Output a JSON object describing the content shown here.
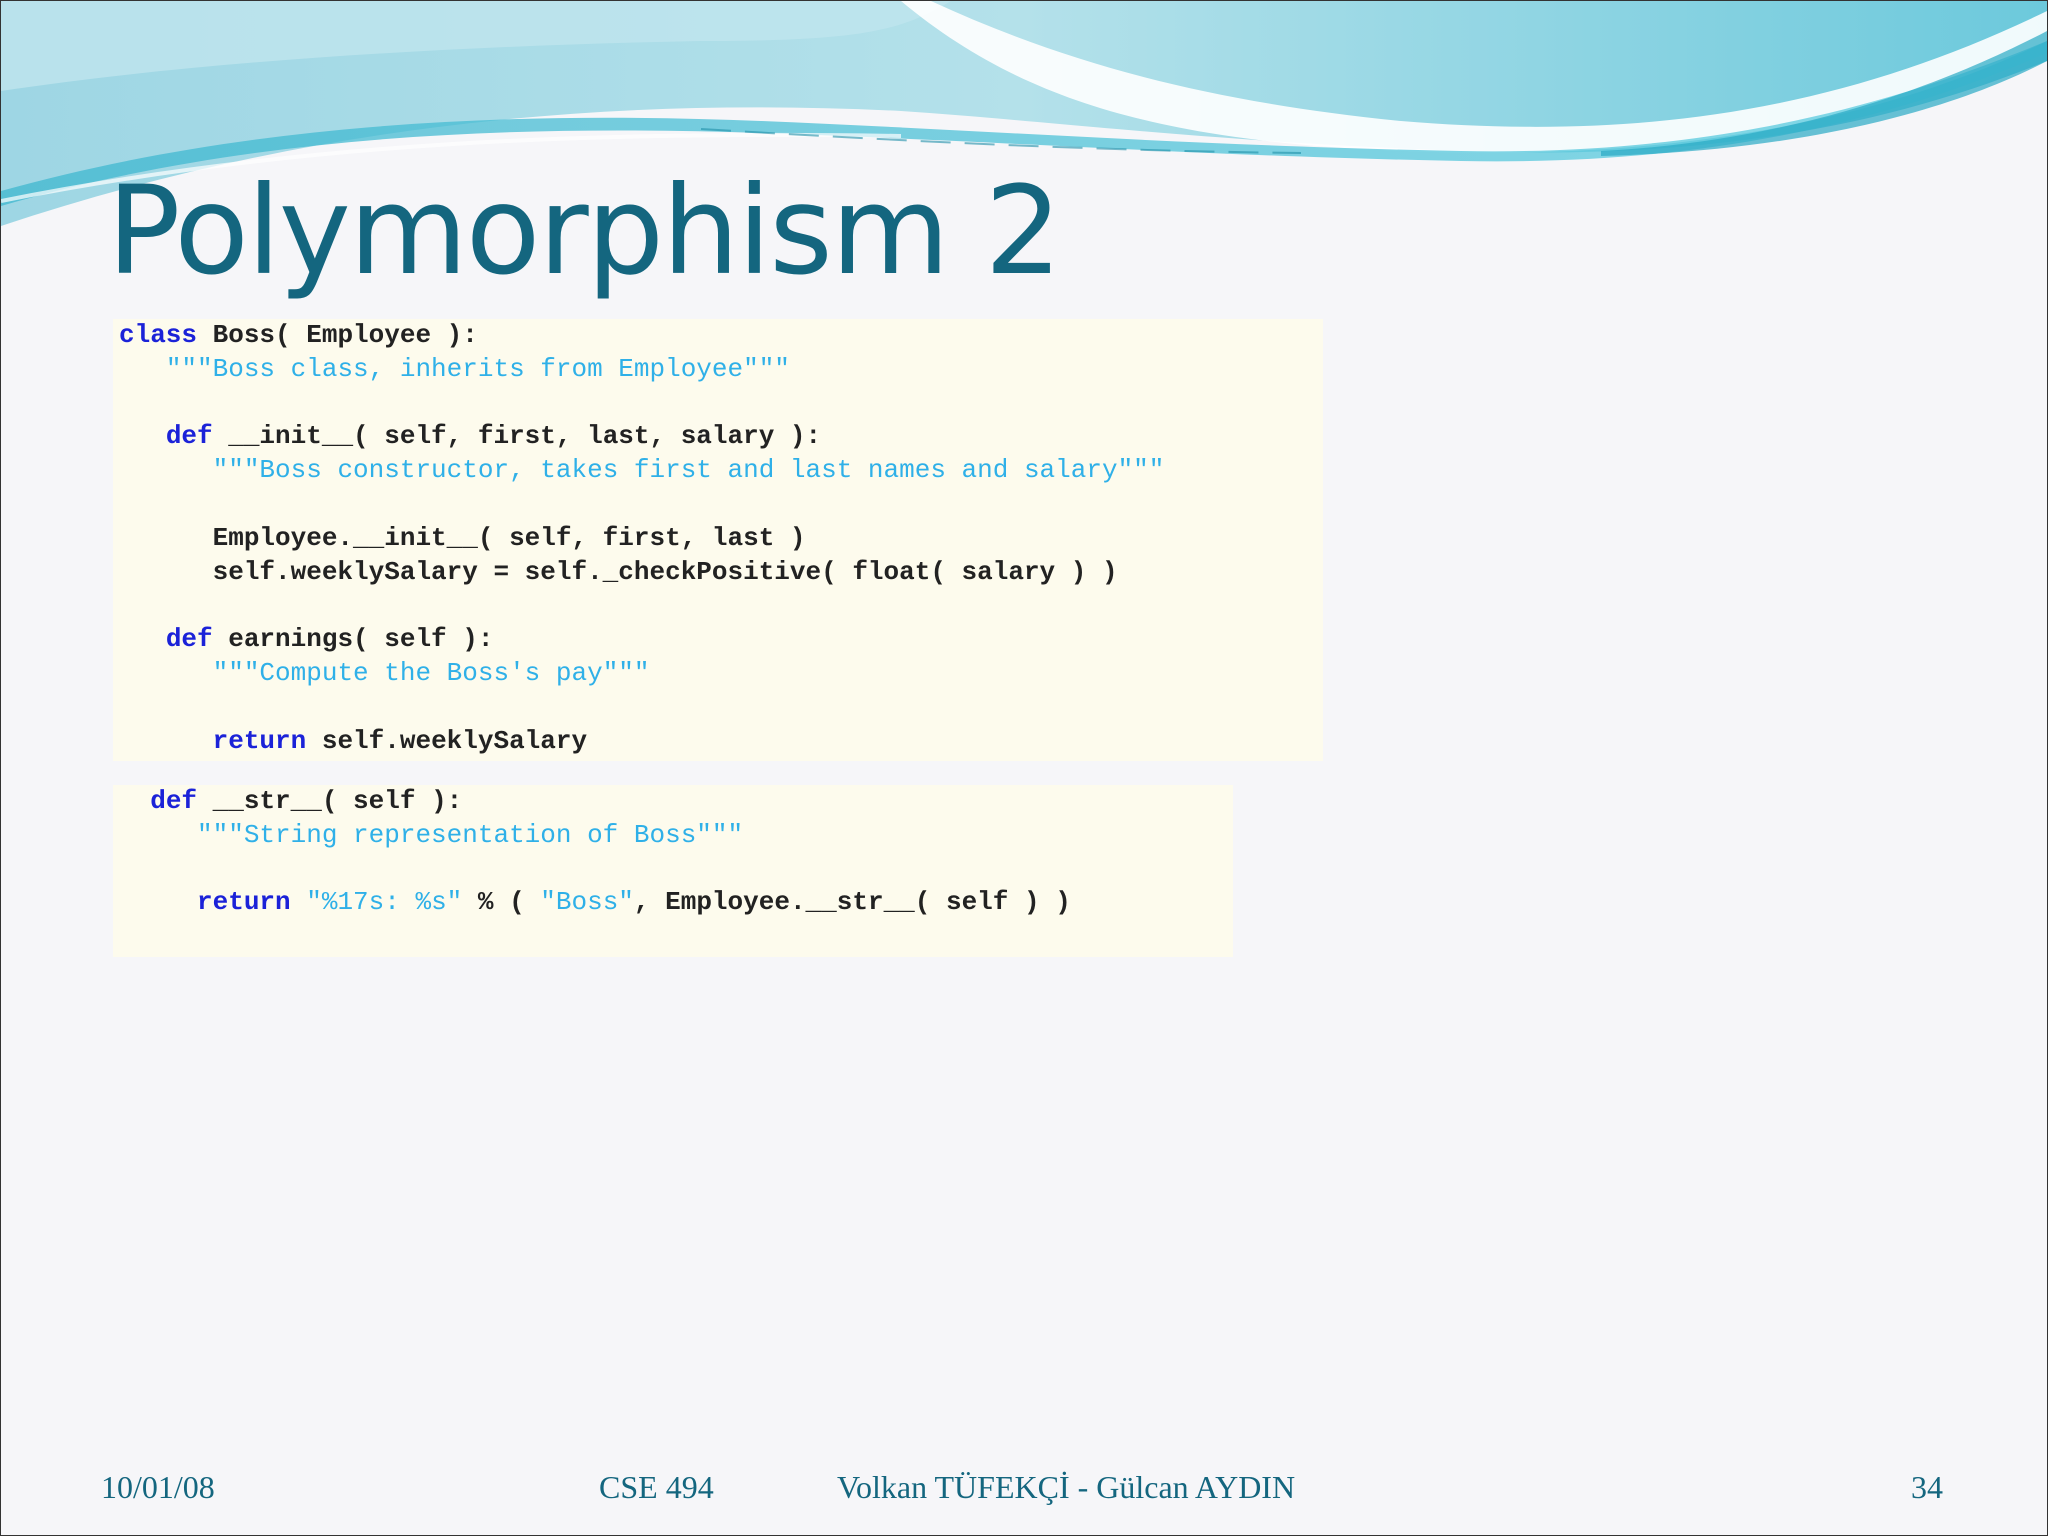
{
  "slide": {
    "title": "Polymorphism 2",
    "footer": {
      "date": "10/01/08",
      "course": "CSE 494",
      "authors": "Volkan TÜFEKÇİ - Gülcan AYDIN",
      "page_number": "34"
    }
  },
  "code_block_1": [
    {
      "segments": [
        {
          "t": "class",
          "k": "kw"
        },
        {
          "t": " Boss( Employee ):",
          "k": "plain"
        }
      ]
    },
    {
      "segments": [
        {
          "t": "   ",
          "k": "plain"
        },
        {
          "t": "\"\"\"Boss class, inherits from Employee\"\"\"",
          "k": "str"
        }
      ]
    },
    {
      "segments": [
        {
          "t": "",
          "k": "plain"
        }
      ]
    },
    {
      "segments": [
        {
          "t": "   ",
          "k": "plain"
        },
        {
          "t": "def",
          "k": "kw"
        },
        {
          "t": " __init__( self, first, last, salary ):",
          "k": "plain"
        }
      ]
    },
    {
      "segments": [
        {
          "t": "      ",
          "k": "plain"
        },
        {
          "t": "\"\"\"Boss constructor, takes first and last names and salary\"\"\"",
          "k": "str"
        }
      ]
    },
    {
      "segments": [
        {
          "t": "",
          "k": "plain"
        }
      ]
    },
    {
      "segments": [
        {
          "t": "      Employee.__init__( self, first, last )",
          "k": "plain"
        }
      ]
    },
    {
      "segments": [
        {
          "t": "      self.weeklySalary = self._checkPositive( float( salary ) )",
          "k": "plain"
        }
      ]
    },
    {
      "segments": [
        {
          "t": "",
          "k": "plain"
        }
      ]
    },
    {
      "segments": [
        {
          "t": "   ",
          "k": "plain"
        },
        {
          "t": "def",
          "k": "kw"
        },
        {
          "t": " earnings( self ):",
          "k": "plain"
        }
      ]
    },
    {
      "segments": [
        {
          "t": "      ",
          "k": "plain"
        },
        {
          "t": "\"\"\"Compute the Boss's pay\"\"\"",
          "k": "str"
        }
      ]
    },
    {
      "segments": [
        {
          "t": "",
          "k": "plain"
        }
      ]
    },
    {
      "segments": [
        {
          "t": "      ",
          "k": "plain"
        },
        {
          "t": "return",
          "k": "kw"
        },
        {
          "t": " self.weeklySalary",
          "k": "plain"
        }
      ]
    }
  ],
  "code_block_2": [
    {
      "segments": [
        {
          "t": "  ",
          "k": "plain"
        },
        {
          "t": "def",
          "k": "kw"
        },
        {
          "t": " __str__( self ):",
          "k": "plain"
        }
      ]
    },
    {
      "segments": [
        {
          "t": "     ",
          "k": "plain"
        },
        {
          "t": "\"\"\"String representation of Boss\"\"\"",
          "k": "str"
        }
      ]
    },
    {
      "segments": [
        {
          "t": "",
          "k": "plain"
        }
      ]
    },
    {
      "segments": [
        {
          "t": "     ",
          "k": "plain"
        },
        {
          "t": "return",
          "k": "kw"
        },
        {
          "t": " ",
          "k": "plain"
        },
        {
          "t": "\"%17s: %s\"",
          "k": "str"
        },
        {
          "t": " % ( ",
          "k": "plain"
        },
        {
          "t": "\"Boss\"",
          "k": "str"
        },
        {
          "t": ", Employee.__str__( self ) )",
          "k": "plain"
        }
      ]
    }
  ],
  "colors": {
    "title": "#14667f",
    "keyword": "#1b22d8",
    "string": "#2fb0e8",
    "code_background": "#fdfbed",
    "wave_teal": "#5ec6d9"
  }
}
